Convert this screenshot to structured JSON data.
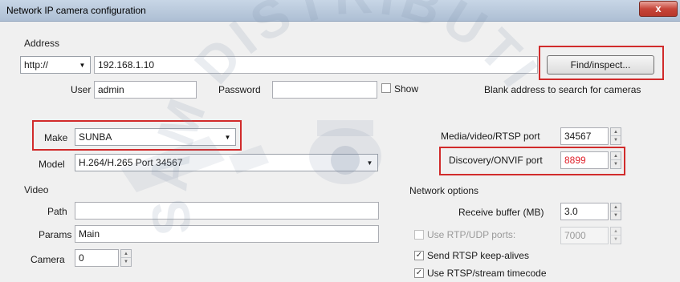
{
  "window": {
    "title": "Network IP camera configuration",
    "close_glyph": "x"
  },
  "address": {
    "section_label": "Address",
    "protocol": "http://",
    "host": "192.168.1.10",
    "find_button": "Find/inspect...",
    "user_label": "User",
    "user_value": "admin",
    "password_label": "Password",
    "password_value": "",
    "show_label": "Show",
    "hint": "Blank address to search for cameras"
  },
  "device": {
    "make_label": "Make",
    "make_value": "SUNBA",
    "model_label": "Model",
    "model_value": "H.264/H.265 Port 34567",
    "rtsp_port_label": "Media/video/RTSP port",
    "rtsp_port_value": "34567",
    "onvif_port_label": "Discovery/ONVIF port",
    "onvif_port_value": "8899",
    "onvif_port_color": "#e0202a"
  },
  "video": {
    "section_label": "Video",
    "path_label": "Path",
    "path_value": "",
    "params_label": "Params",
    "params_value": "Main",
    "camera_label": "Camera",
    "camera_value": "0"
  },
  "network": {
    "section_label": "Network options",
    "buffer_label": "Receive buffer (MB)",
    "buffer_value": "3.0",
    "rtp_udp_label": "Use RTP/UDP ports:",
    "rtp_udp_value": "7000",
    "rtp_udp_checked": false,
    "keepalive_label": "Send RTSP keep-alives",
    "keepalive_checked": true,
    "timecode_label": "Use RTSP/stream timecode",
    "timecode_checked": true
  },
  "watermark": {
    "text": "SAM DISTRIBUTION INC"
  },
  "colors": {
    "highlight_border": "#d12b2b",
    "titlebar": "#b9c9dc",
    "close_button": "#c7463a"
  }
}
